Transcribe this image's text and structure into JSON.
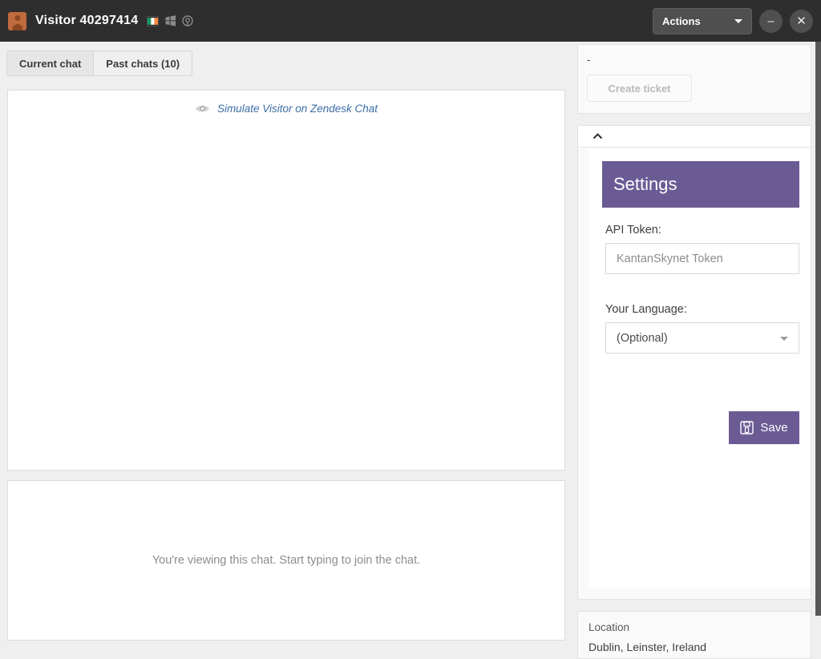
{
  "titlebar": {
    "visitor_name": "Visitor 40297414",
    "avatar_icon": "user-avatar-icon",
    "flag_icon": "flag-ireland-icon",
    "os_icon": "windows-logo-icon",
    "browser_icon": "browser-globe-icon",
    "actions_label": "Actions",
    "minimize_label": "–",
    "close_label": "✕",
    "bg_color": "#2e2e2e"
  },
  "tabs": [
    {
      "label": "Current chat",
      "active": true
    },
    {
      "label": "Past chats (10)",
      "active": false
    }
  ],
  "chat": {
    "simulate_link": "Simulate Visitor on Zendesk Chat",
    "simulate_icon": "eye-icon",
    "compose_hint": "You're viewing this chat. Start typing to join the chat."
  },
  "sidebar": {
    "ticket": {
      "dash": "-",
      "create_ticket_label": "Create ticket"
    },
    "app": {
      "collapse_icon": "chevron-up-icon",
      "settings_title": "Settings",
      "api_token_label": "API Token:",
      "api_token_value": "",
      "api_token_placeholder": "KantanSkynet Token",
      "language_label": "Your Language:",
      "language_value": "(Optional)",
      "save_label": "Save",
      "save_icon": "floppy-save-icon",
      "accent_color": "#6b5b95"
    },
    "location": {
      "title": "Location",
      "value": "Dublin, Leinster, Ireland"
    }
  }
}
